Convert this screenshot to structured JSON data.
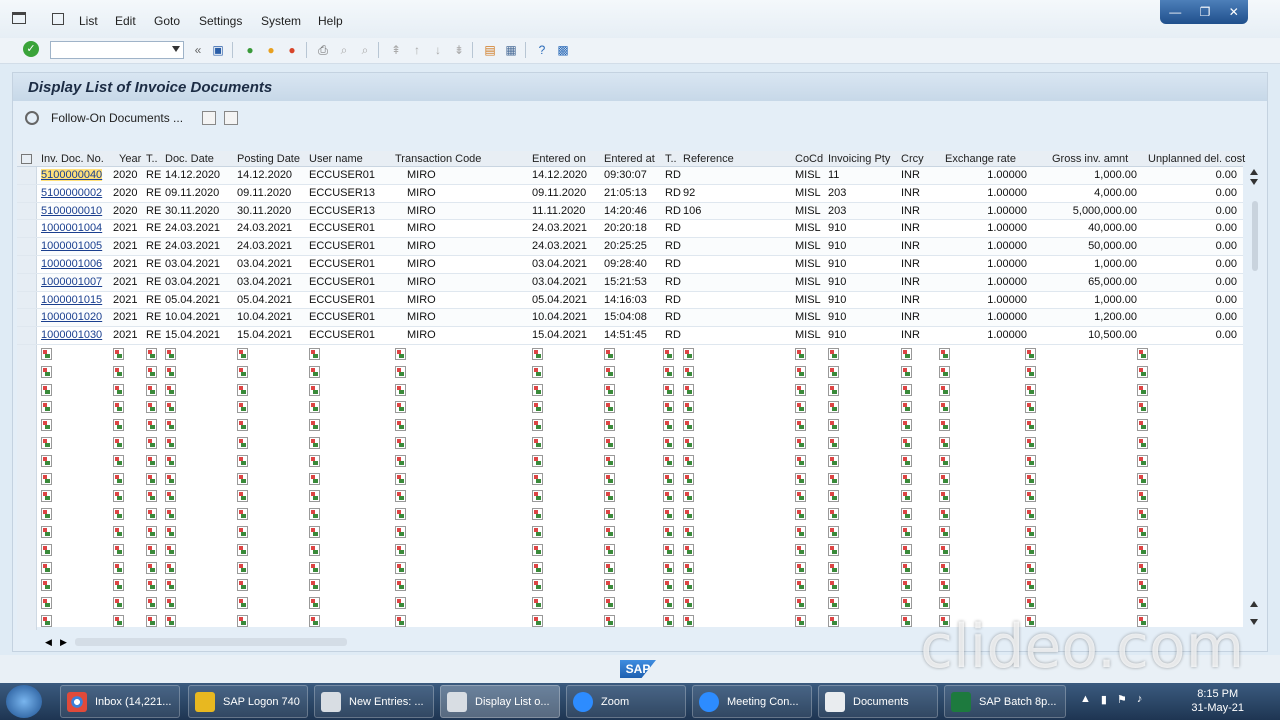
{
  "menu": [
    "List",
    "Edit",
    "Goto",
    "Settings",
    "System",
    "Help"
  ],
  "window_controls": [
    "—",
    "❐",
    "✕"
  ],
  "toolbar": {
    "command_value": ""
  },
  "page": {
    "title": "Display List of Invoice Documents",
    "followon_label": "Follow-On Documents ..."
  },
  "columns": [
    "Inv. Doc. No.",
    "Year",
    "T..",
    "Doc. Date",
    "Posting Date",
    "User name",
    "Transaction Code",
    "Entered on",
    "Entered at",
    "T..",
    "Reference",
    "CoCd",
    "Invoicing Pty",
    "Crcy",
    "Exchange rate",
    "Gross inv. amnt",
    "Unplanned del. cost"
  ],
  "rows": [
    [
      "5100000040",
      "2020",
      "RE",
      "14.12.2020",
      "14.12.2020",
      "ECCUSER01",
      "MIRO",
      "14.12.2020",
      "09:30:07",
      "RD",
      "",
      "MISL",
      "11",
      "INR",
      "1.00000",
      "1,000.00",
      "0.00"
    ],
    [
      "5100000002",
      "2020",
      "RE",
      "09.11.2020",
      "09.11.2020",
      "ECCUSER13",
      "MIRO",
      "09.11.2020",
      "21:05:13",
      "RD",
      "92",
      "MISL",
      "203",
      "INR",
      "1.00000",
      "4,000.00",
      "0.00"
    ],
    [
      "5100000010",
      "2020",
      "RE",
      "30.11.2020",
      "30.11.2020",
      "ECCUSER13",
      "MIRO",
      "11.11.2020",
      "14:20:46",
      "RD",
      "106",
      "MISL",
      "203",
      "INR",
      "1.00000",
      "5,000,000.00",
      "0.00"
    ],
    [
      "1000001004",
      "2021",
      "RE",
      "24.03.2021",
      "24.03.2021",
      "ECCUSER01",
      "MIRO",
      "24.03.2021",
      "20:20:18",
      "RD",
      "",
      "MISL",
      "910",
      "INR",
      "1.00000",
      "40,000.00",
      "0.00"
    ],
    [
      "1000001005",
      "2021",
      "RE",
      "24.03.2021",
      "24.03.2021",
      "ECCUSER01",
      "MIRO",
      "24.03.2021",
      "20:25:25",
      "RD",
      "",
      "MISL",
      "910",
      "INR",
      "1.00000",
      "50,000.00",
      "0.00"
    ],
    [
      "1000001006",
      "2021",
      "RE",
      "03.04.2021",
      "03.04.2021",
      "ECCUSER01",
      "MIRO",
      "03.04.2021",
      "09:28:40",
      "RD",
      "",
      "MISL",
      "910",
      "INR",
      "1.00000",
      "1,000.00",
      "0.00"
    ],
    [
      "1000001007",
      "2021",
      "RE",
      "03.04.2021",
      "03.04.2021",
      "ECCUSER01",
      "MIRO",
      "03.04.2021",
      "15:21:53",
      "RD",
      "",
      "MISL",
      "910",
      "INR",
      "1.00000",
      "65,000.00",
      "0.00"
    ],
    [
      "1000001015",
      "2021",
      "RE",
      "05.04.2021",
      "05.04.2021",
      "ECCUSER01",
      "MIRO",
      "05.04.2021",
      "14:16:03",
      "RD",
      "",
      "MISL",
      "910",
      "INR",
      "1.00000",
      "1,000.00",
      "0.00"
    ],
    [
      "1000001020",
      "2021",
      "RE",
      "10.04.2021",
      "10.04.2021",
      "ECCUSER01",
      "MIRO",
      "10.04.2021",
      "15:04:08",
      "RD",
      "",
      "MISL",
      "910",
      "INR",
      "1.00000",
      "1,200.00",
      "0.00"
    ],
    [
      "1000001030",
      "2021",
      "RE",
      "15.04.2021",
      "15.04.2021",
      "ECCUSER01",
      "MIRO",
      "15.04.2021",
      "14:51:45",
      "RD",
      "",
      "MISL",
      "910",
      "INR",
      "1.00000",
      "10,500.00",
      "0.00"
    ]
  ],
  "empty_row_count": 16,
  "sap_logo": "SAP",
  "watermark": "clideo.com",
  "taskbar": {
    "items": [
      "Inbox (14,221...",
      "SAP Logon 740",
      "New Entries: ...",
      "Display List o...",
      "Zoom",
      "Meeting Con...",
      "Documents",
      "SAP Batch 8p..."
    ],
    "time": "8:15 PM",
    "date": "31-May-21"
  },
  "colors": {
    "accent": "#1a3f8f",
    "highlight": "#ffe07a",
    "ok": "#3aa33a"
  }
}
